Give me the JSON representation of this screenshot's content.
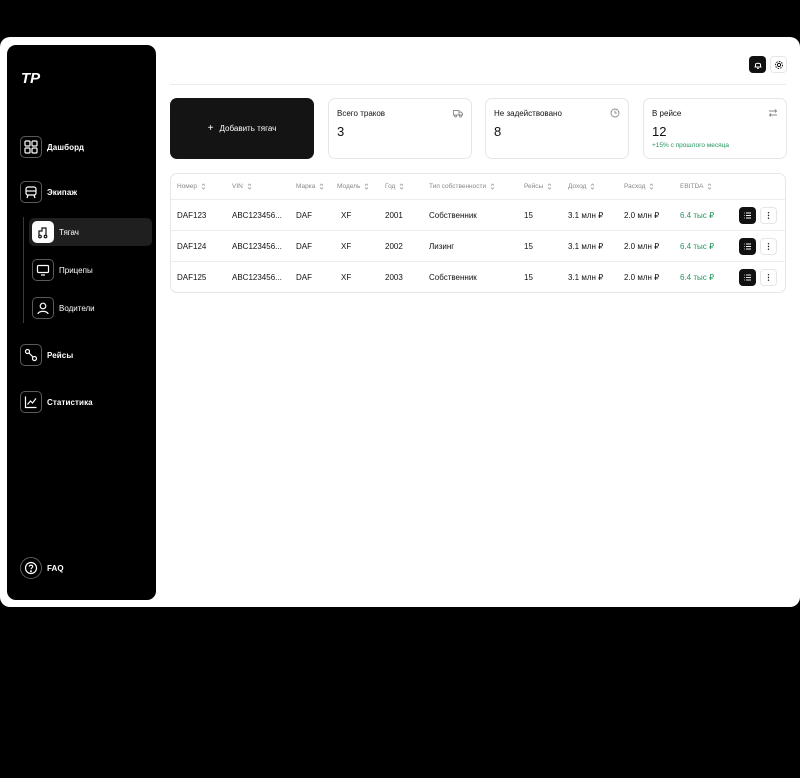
{
  "brand": {
    "logo_text": "ТР"
  },
  "sidebar": {
    "items": [
      {
        "label": "Дашборд",
        "icon": "dashboard-icon"
      },
      {
        "label": "Экипаж",
        "icon": "crew-icon"
      },
      {
        "label": "Рейсы",
        "icon": "route-icon"
      },
      {
        "label": "Статистика",
        "icon": "chart-icon"
      }
    ],
    "sub_items": [
      {
        "label": "Тягач",
        "icon": "truck-tractor-icon",
        "active": true
      },
      {
        "label": "Прицепы",
        "icon": "trailer-icon",
        "active": false
      },
      {
        "label": "Водители",
        "icon": "driver-icon",
        "active": false
      }
    ],
    "faq_label": "FAQ"
  },
  "header": {
    "bell_icon": "bell-icon",
    "settings_icon": "gear-icon"
  },
  "add_card": {
    "label": "Добавить тягач"
  },
  "stats": [
    {
      "title": "Всего траков",
      "value": "3",
      "icon": "truck-icon"
    },
    {
      "title": "Не задействовано",
      "value": "8",
      "icon": "clock-icon"
    },
    {
      "title": "В рейсе",
      "value": "12",
      "icon": "swap-icon",
      "delta": "+15% с прошлого месяца"
    }
  ],
  "table": {
    "columns": [
      "Номер",
      "VIN",
      "Марка",
      "Модель",
      "Год",
      "Тип собственности",
      "Рейсы",
      "Доход",
      "Расход",
      "EBITDA"
    ],
    "rows": [
      [
        "DAF123",
        "ABC123456...",
        "DAF",
        "XF",
        "2001",
        "Собственник",
        "15",
        "3.1 млн ₽",
        "2.0 млн ₽",
        "6.4 тыс ₽"
      ],
      [
        "DAF124",
        "ABC123456...",
        "DAF",
        "XF",
        "2002",
        "Лизинг",
        "15",
        "3.1 млн ₽",
        "2.0 млн ₽",
        "6.4 тыс ₽"
      ],
      [
        "DAF125",
        "ABC123456...",
        "DAF",
        "XF",
        "2003",
        "Собственник",
        "15",
        "3.1 млн ₽",
        "2.0 млн ₽",
        "6.4 тыс ₽"
      ]
    ]
  },
  "colors": {
    "accent_green": "#23955b",
    "sidebar_bg": "#000000",
    "card_dark": "#141414"
  }
}
